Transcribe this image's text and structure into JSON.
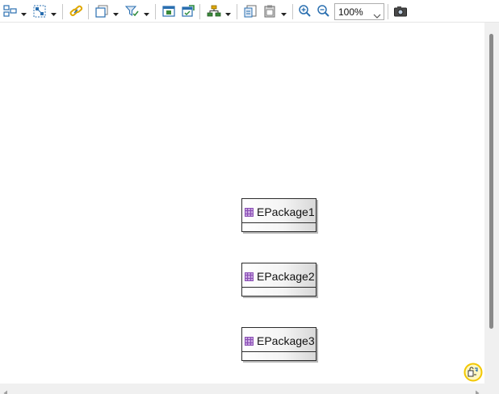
{
  "toolbar": {
    "icons": [
      "arrange-all-icon",
      "select-all-icon",
      "link-icon",
      "layers-icon",
      "filters-icon",
      "show-elements-icon",
      "hide-elements-icon",
      "layout-icon",
      "copy-format-icon",
      "paste-format-icon",
      "zoom-in-icon",
      "zoom-out-icon",
      "export-image-icon"
    ],
    "zoom": {
      "value": "100%"
    }
  },
  "diagram": {
    "nodes": [
      {
        "label": "EPackage1",
        "icon": "epackage-icon"
      },
      {
        "label": "EPackage2",
        "icon": "epackage-icon"
      },
      {
        "label": "EPackage3",
        "icon": "epackage-icon"
      }
    ]
  },
  "colors": {
    "package_icon": "#8a4fb5",
    "accent_yellow": "#f2c700",
    "toolbar_blue": "#2a6fb0"
  }
}
